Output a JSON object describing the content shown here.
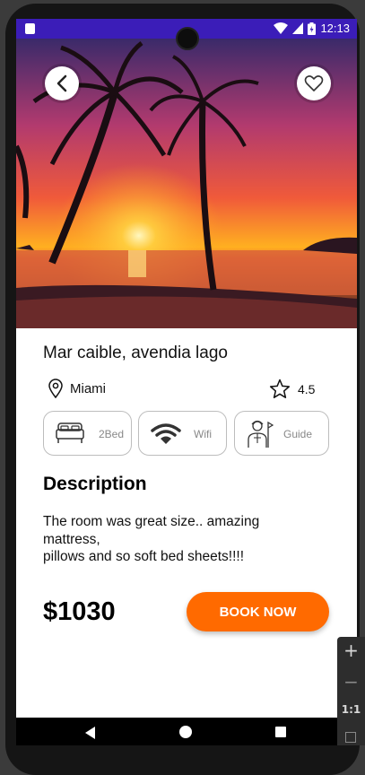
{
  "status_bar": {
    "time": "12:13"
  },
  "listing": {
    "title": "Mar caible, avendia lago",
    "location": "Miami",
    "rating": "4.5",
    "amenities": [
      {
        "icon": "bed-icon",
        "label": "2Bed"
      },
      {
        "icon": "wifi-icon",
        "label": "Wifi"
      },
      {
        "icon": "guide-icon",
        "label": "Guide"
      }
    ],
    "description_heading": "Description",
    "description": "The room was great size.. amazing mattress,\npillows and so soft bed sheets!!!!",
    "price": "$1030",
    "book_label": "BOOK NOW"
  },
  "emulator_toolbar": {
    "zoom_in": "+",
    "zoom_out": "−",
    "ratio": "1:1"
  },
  "colors": {
    "accent": "#ff6a00",
    "status_bar": "#3b1db8"
  }
}
